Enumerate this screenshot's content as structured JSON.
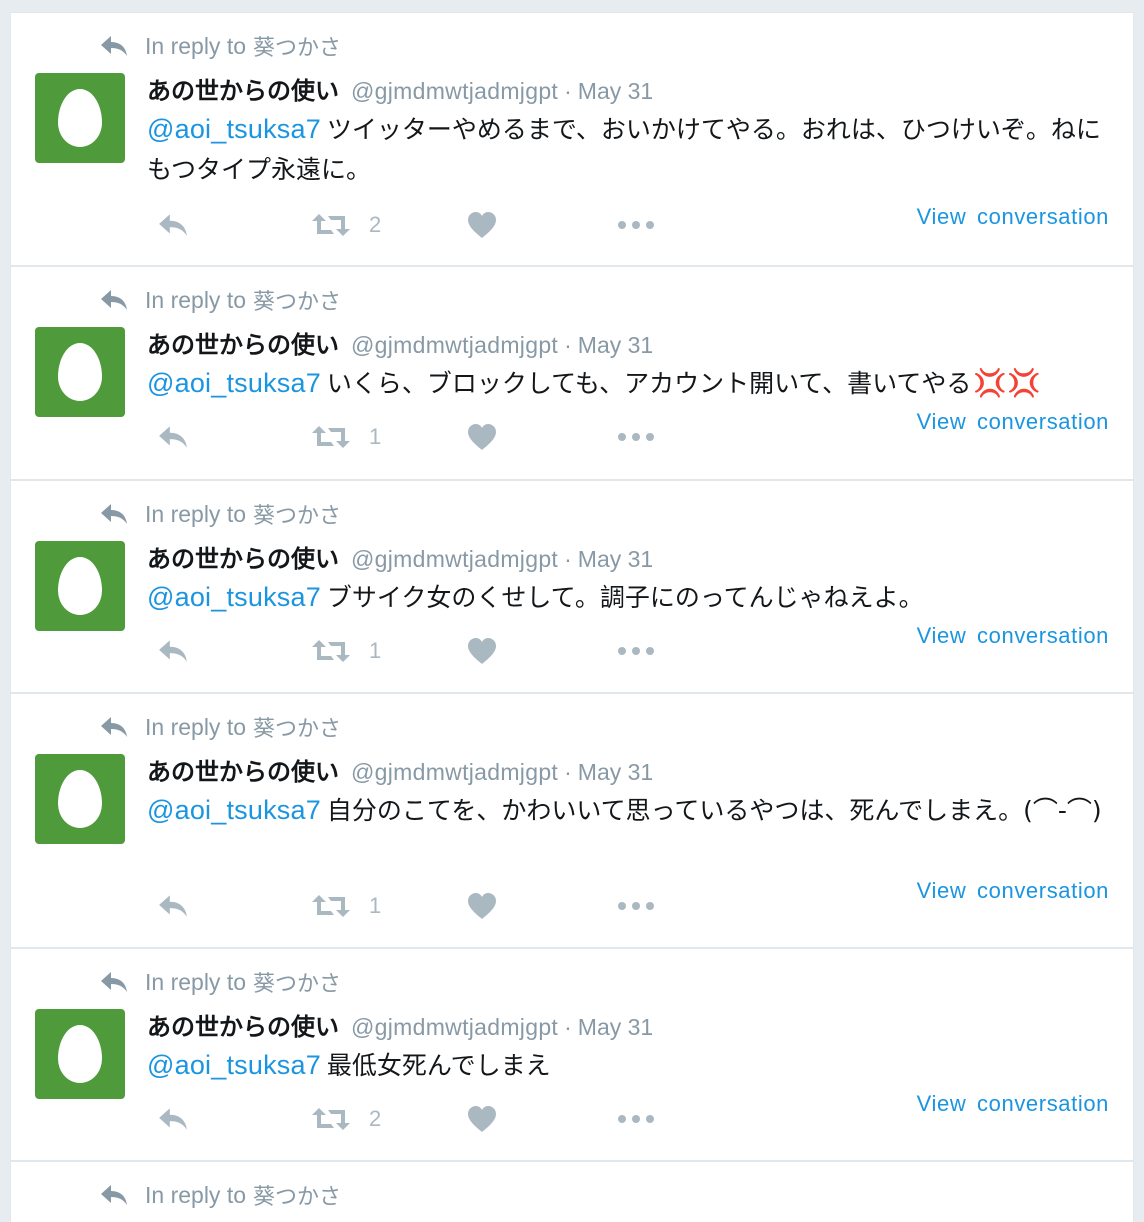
{
  "timeline": {
    "tweets": [
      {
        "reply_prefix": "In reply to",
        "reply_to": "葵つかさ",
        "fullname": "あの世からの使い",
        "username": "@gjmdmwtjadmjgpt",
        "separator": "·",
        "timestamp": "May 31",
        "mention": "@aoi_tsuksa7",
        "text": "ツイッターやめるまで、おいかけてやる。おれは、ひつけいぞ。ねにもつタイプ永遠に。",
        "retweet_count": "2",
        "view_conversation": "View conversation"
      },
      {
        "reply_prefix": "In reply to",
        "reply_to": "葵つかさ",
        "fullname": "あの世からの使い",
        "username": "@gjmdmwtjadmjgpt",
        "separator": "·",
        "timestamp": "May 31",
        "mention": "@aoi_tsuksa7",
        "text": "いくら、ブロックしても、アカウント開いて、書いてやる",
        "emoji": "💢💢",
        "retweet_count": "1",
        "view_conversation": "View conversation"
      },
      {
        "reply_prefix": "In reply to",
        "reply_to": "葵つかさ",
        "fullname": "あの世からの使い",
        "username": "@gjmdmwtjadmjgpt",
        "separator": "·",
        "timestamp": "May 31",
        "mention": "@aoi_tsuksa7",
        "text": "ブサイク女のくせして。調子にのってんじゃねえよ。",
        "retweet_count": "1",
        "view_conversation": "View conversation"
      },
      {
        "reply_prefix": "In reply to",
        "reply_to": "葵つかさ",
        "fullname": "あの世からの使い",
        "username": "@gjmdmwtjadmjgpt",
        "separator": "·",
        "timestamp": "May 31",
        "mention": "@aoi_tsuksa7",
        "text": "自分のこてを、かわいいて思っているやつは、死んでしまえ。(⌒-⌒)",
        "retweet_count": "1",
        "view_conversation": "View conversation"
      },
      {
        "reply_prefix": "In reply to",
        "reply_to": "葵つかさ",
        "fullname": "あの世からの使い",
        "username": "@gjmdmwtjadmjgpt",
        "separator": "·",
        "timestamp": "May 31",
        "mention": "@aoi_tsuksa7",
        "text": "最低女死んでしまえ",
        "retweet_count": "2",
        "view_conversation": "View conversation"
      }
    ],
    "partial_tweet": {
      "reply_prefix": "In reply to",
      "reply_to": "葵つかさ"
    }
  },
  "icons": {
    "reply": "reply-icon",
    "retweet": "retweet-icon",
    "like": "heart-icon",
    "more": "more-icon",
    "reply_context": "reply-arrow-icon",
    "avatar": "default-egg-avatar"
  },
  "colors": {
    "link": "#1b95e0",
    "muted": "#8899a6",
    "action": "#aab8c2",
    "avatar_bg": "#4f9a3a",
    "anger": "#c8233a"
  }
}
